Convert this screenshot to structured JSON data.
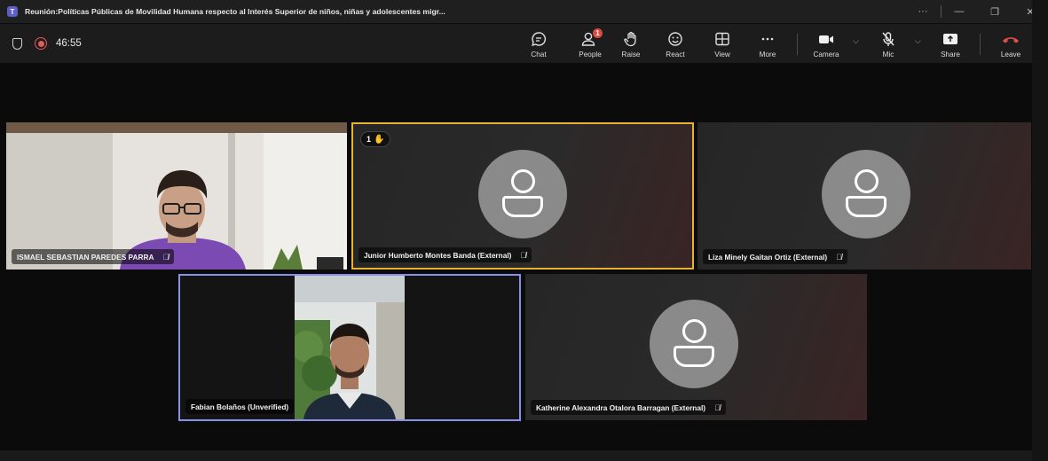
{
  "window": {
    "title": "Reunión:Políticas Públicas de Movilidad Humana respecto al Interés Superior de niños, niñas y adolescentes migr...",
    "more_label": "···",
    "minimize_label": "—",
    "restore_label": "❐",
    "close_label": "✕"
  },
  "toolbar": {
    "timer": "46:55",
    "people_badge": "1",
    "items": [
      {
        "label": "Chat",
        "icon": "chat-icon"
      },
      {
        "label": "People",
        "icon": "people-icon"
      },
      {
        "label": "Raise",
        "icon": "hand-icon"
      },
      {
        "label": "React",
        "icon": "smiley-icon"
      },
      {
        "label": "View",
        "icon": "grid-icon"
      },
      {
        "label": "More",
        "icon": "more-icon"
      },
      {
        "label": "Camera",
        "icon": "camera-icon"
      },
      {
        "label": "Mic",
        "icon": "mic-off-icon"
      },
      {
        "label": "Share",
        "icon": "share-icon"
      },
      {
        "label": "Leave",
        "icon": "hangup-icon"
      }
    ],
    "colors": {
      "leave": "#e0504a",
      "raised_hand_border": "#e8b22f",
      "speaker_border": "#8c8fe6"
    }
  },
  "participants": [
    {
      "name": "ISMAEL SEBASTIAN PAREDES PARRA",
      "muted": true,
      "video": true
    },
    {
      "name": "Junior Humberto Montes Banda (External)",
      "muted": true,
      "video": false,
      "hand_raised": "1"
    },
    {
      "name": "Liza Minely Gaitan Ortiz (External)",
      "muted": true,
      "video": false
    },
    {
      "name": "Fabian Bolaños (Unverified)",
      "muted": false,
      "video": true
    },
    {
      "name": "Katherine Alexandra Otalora Barragan (External)",
      "muted": true,
      "video": false
    }
  ]
}
